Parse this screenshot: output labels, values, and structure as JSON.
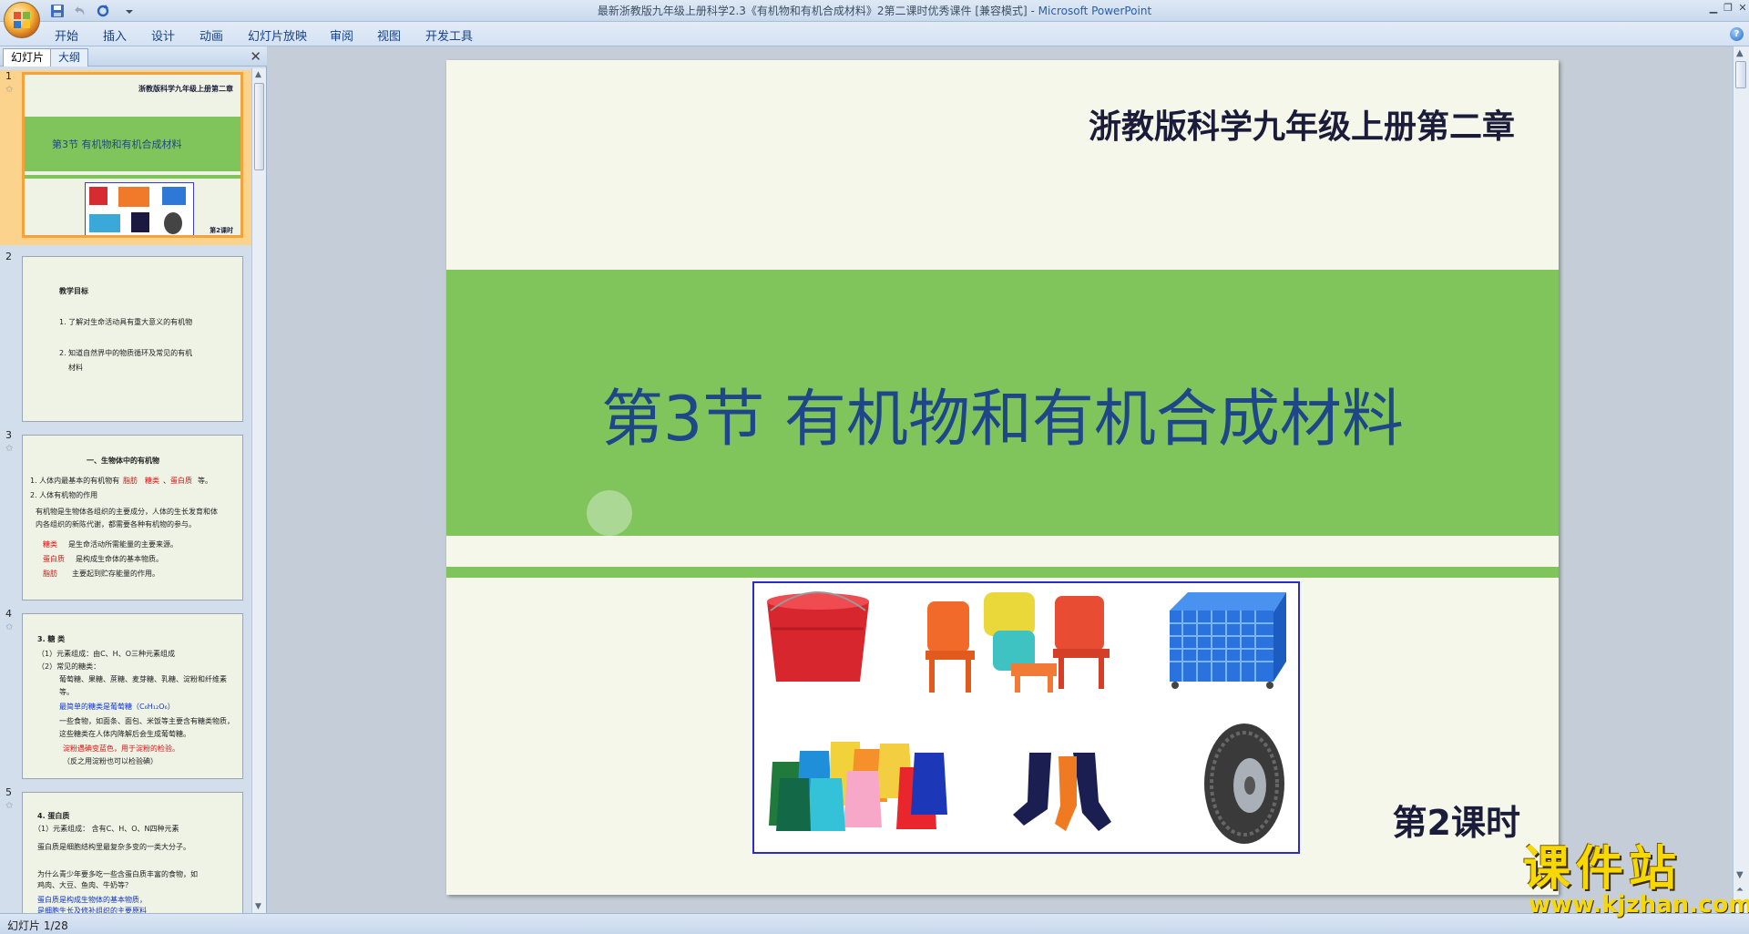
{
  "window": {
    "title_doc": "最新浙教版九年级上册科学2.3《有机物和有机合成材料》2第二课时优秀课件 [兼容模式] - ",
    "title_app": "Microsoft PowerPoint"
  },
  "ribbon": {
    "tabs": [
      "开始",
      "插入",
      "设计",
      "动画",
      "幻灯片放映",
      "审阅",
      "视图",
      "开发工具"
    ]
  },
  "pane": {
    "tabs": [
      "幻灯片",
      "大纲"
    ],
    "close": "✕"
  },
  "thumbnails": [
    {
      "num": "1",
      "header": "浙教版科学九年级上册第二章",
      "title": "第3节  有机物和有机合成材料",
      "lesson": "第2课时"
    },
    {
      "num": "2",
      "heading": "教学目标",
      "line1": "1. 了解对生命活动具有重大意义的有机物",
      "line2": "2. 知道自然界中的物质循环及常见的有机",
      "line3": "材料"
    },
    {
      "num": "3",
      "heading": "一、生物体中的有机物",
      "line1": "1. 人体内最基本的有机物有",
      "line1_words": [
        "糖类",
        "、",
        "蛋白质",
        "等。"
      ],
      "line1_blank": "脂肪",
      "line2": "2. 人体有机物的作用",
      "line3": "有机物是生物体各组织的主要成分，人体的生长发育和体",
      "line4": "内各组织的新陈代谢，都需要各种有机物的参与。",
      "line5a": "糖类",
      "line5b": "是生命活动所需能量的主要来源。",
      "line6a": "蛋白质",
      "line6b": "是构成生命体的基本物质。",
      "line7a": "脂肪",
      "line7b": "主要起到贮存能量的作用。"
    },
    {
      "num": "4",
      "heading": "3. 糖   类",
      "line1": "（1）元素组成：由C、H、O三种元素组成",
      "line2": "（2）常见的糖类：",
      "line3": "葡萄糖、果糖、蔗糖、麦芽糖、乳糖、淀粉和纤维素",
      "line4": "等。",
      "line5": "最简单的糖类是葡萄糖（C₆H₁₂O₆）",
      "line6": "一些食物，如面条、面包、米饭等主要含有糖类物质，",
      "line7": "这些糖类在人体内降解后会生成葡萄糖。",
      "line8": "淀粉遇碘变蓝色，用于淀粉的检验。",
      "line9": "（反之用淀粉也可以检验碘）"
    },
    {
      "num": "5",
      "heading": "4. 蛋白质",
      "line1": "（1）元素组成：      含有C、H、O、N四种元素",
      "line2": "蛋白质是细胞结构里最复杂多变的一类大分子。",
      "line3": "为什么青少年要多吃一些含蛋白质丰富的食物，如",
      "line4": "鸡肉、大豆、鱼肉、牛奶等？",
      "line5": "蛋白质是构成生物体的基本物质，",
      "line6": "是细胞生长及修补组织的主要原料"
    }
  ],
  "slide": {
    "header": "浙教版科学九年级上册第二章",
    "title": "第3节  有机物和有机合成材料",
    "lesson": "第2课时"
  },
  "status": {
    "text": "幻灯片 1/28"
  },
  "watermark": {
    "title": "课件站",
    "url": "www.kjzhan.com"
  },
  "colors": {
    "band_green": "#80c45c",
    "title_blue": "#1f4688",
    "slide_bg": "#f4f7ea"
  }
}
